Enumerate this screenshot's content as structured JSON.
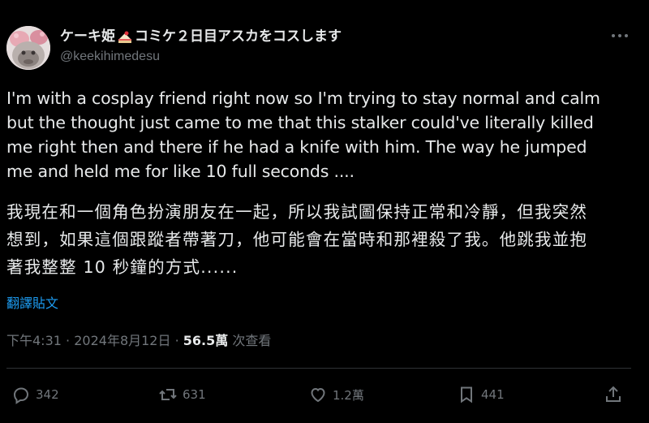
{
  "author": {
    "display_name_prefix": "ケーキ姫",
    "display_name_suffix": "コミケ２日目アスカをコスします",
    "handle": "@keekihimedesu"
  },
  "tweet": {
    "text": "I'm with a cosplay friend right now so I'm trying to stay normal and calm\nbut the thought just came to me that this stalker could've literally killed\nme right then and there if he had a knife with him. The way he jumped\nme and held me for like 10 full seconds ....",
    "translation": "我現在和一個角色扮演朋友在一起，所以我試圖保持正常和冷靜，但我突然\n想到，如果這個跟蹤者帶著刀，他可能會在當時和那裡殺了我。他跳我並抱\n著我整整 10 秒鐘的方式......",
    "translate_link": "翻譯貼文"
  },
  "meta": {
    "time": "下午4:31",
    "separator": "·",
    "date": "2024年8月12日",
    "views_count": "56.5萬",
    "views_label": "次查看"
  },
  "actions": {
    "replies": "342",
    "reposts": "631",
    "likes": "1.2萬",
    "bookmarks": "441"
  },
  "colors": {
    "background": "#000000",
    "text": "#e7e9ea",
    "secondary": "#71767b",
    "link": "#1d9bf0",
    "divider": "#2f3336"
  },
  "icons": [
    "avatar-image",
    "cake-emoji-icon",
    "more-icon",
    "reply-icon",
    "repost-icon",
    "like-icon",
    "bookmark-icon",
    "share-icon"
  ]
}
